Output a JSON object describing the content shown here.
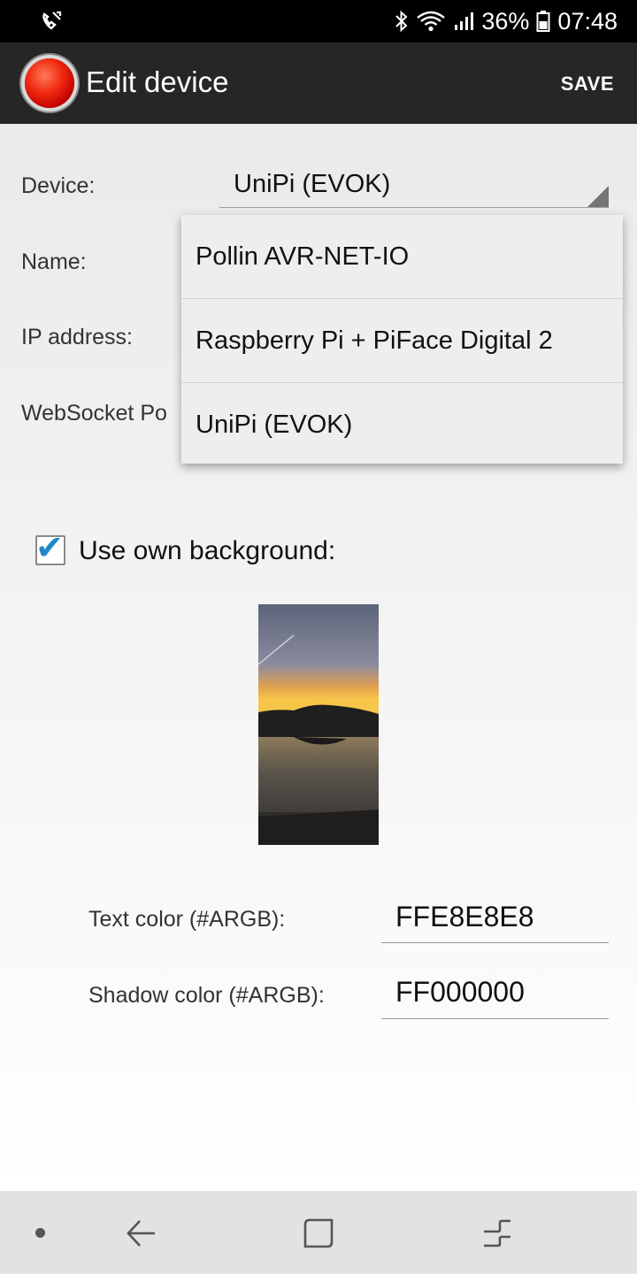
{
  "status_bar": {
    "left_icon": "call-transfer-icon",
    "icons": [
      "bluetooth-icon",
      "wifi-icon",
      "signal-icon"
    ],
    "battery_percent": "36%",
    "battery_icon": "battery-icon",
    "time": "07:48"
  },
  "app_bar": {
    "icon": "red-button-app-icon",
    "title": "Edit device",
    "save_label": "SAVE"
  },
  "form": {
    "device_label": "Device:",
    "device_value": "UniPi (EVOK)",
    "name_label": "Name:",
    "ip_label": "IP address:",
    "websocket_label": "WebSocket Po",
    "use_own_background_label": "Use own background:",
    "use_own_background_checked": true,
    "text_color_label": "Text color (#ARGB):",
    "text_color_value": "FFE8E8E8",
    "shadow_color_label": "Shadow color (#ARGB):",
    "shadow_color_value": "FF000000"
  },
  "dropdown": {
    "options": [
      "Pollin AVR-NET-IO",
      "Raspberry Pi + PiFace Digital 2",
      "UniPi (EVOK)"
    ]
  },
  "colors": {
    "app_bar": "#262626",
    "status_bar": "#000000",
    "checkbox_accent": "#1f88c9"
  },
  "nav_bar": {
    "icons": [
      "dot-icon",
      "back-icon",
      "overview-icon",
      "recents-icon"
    ]
  }
}
